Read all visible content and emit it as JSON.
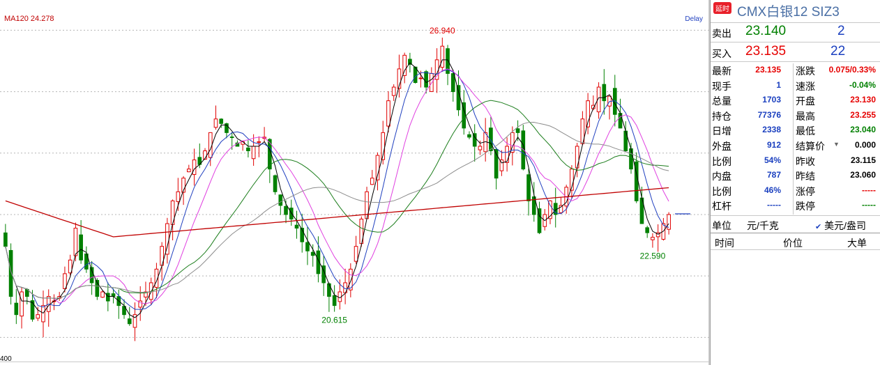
{
  "chart_data": {
    "type": "candlestick",
    "ma_label": "MA120 24.278",
    "delay_label": "Delay",
    "x_axis_label": "400",
    "annotations": [
      {
        "text": "26.940",
        "kind": "high"
      },
      {
        "text": "20.615",
        "kind": "low"
      },
      {
        "text": "22.590",
        "kind": "low"
      }
    ],
    "ylim": [
      19.9,
      27.6
    ],
    "grid_y": [
      27.15,
      25.8,
      24.45,
      23.1,
      21.75,
      20.4
    ],
    "close_series": [
      22.4,
      21.3,
      20.9,
      21.4,
      21.3,
      20.8,
      20.9,
      21.1,
      21.3,
      21.2,
      21.3,
      21.8,
      22.1,
      22.8,
      22.1,
      21.9,
      21.6,
      21.3,
      21.4,
      21.2,
      21.3,
      21.1,
      20.9,
      20.7,
      20.9,
      21.2,
      21.4,
      21.6,
      21.9,
      22.4,
      22.9,
      23.4,
      23.6,
      23.9,
      24.1,
      24.3,
      24.2,
      24.5,
      24.9,
      25.2,
      25.1,
      24.9,
      24.8,
      24.6,
      24.7,
      24.5,
      24.6,
      24.7,
      24.8,
      24.1,
      23.6,
      23.3,
      23.1,
      23.0,
      22.8,
      22.5,
      22.3,
      22.2,
      21.8,
      21.6,
      21.3,
      21.1,
      21.4,
      21.6,
      21.9,
      22.4,
      23.0,
      23.6,
      23.9,
      24.4,
      24.9,
      25.6,
      25.9,
      26.3,
      26.6,
      26.4,
      26.0,
      26.1,
      25.9,
      26.2,
      26.5,
      26.8,
      26.2,
      25.8,
      25.4,
      25.0,
      24.8,
      24.6,
      24.6,
      24.9,
      24.5,
      23.9,
      24.3,
      24.6,
      24.9,
      24.9,
      24.1,
      23.4,
      23.1,
      22.7,
      23.1,
      23.4,
      23.1,
      23.3,
      23.7,
      24.1,
      24.6,
      25.2,
      25.6,
      25.5,
      25.9,
      25.6,
      25.7,
      25.3,
      25.0,
      24.5,
      24.1,
      23.4,
      22.9,
      22.7,
      22.6,
      22.7,
      22.9,
      23.1
    ],
    "y_labels": [],
    "ma_series": [
      {
        "name": "MA5",
        "color": "#000000"
      },
      {
        "name": "MA10",
        "color": "#1f3fbf"
      },
      {
        "name": "MA20",
        "color": "#e040e0"
      },
      {
        "name": "MA60",
        "color": "#1b7d1b"
      },
      {
        "name": "MA90",
        "color": "#8c8c8c"
      },
      {
        "name": "MA120",
        "color": "#c00000"
      }
    ],
    "colors": {
      "up": "#e00000",
      "down": "#008000",
      "grid": "#b4b4b4"
    }
  },
  "quote": {
    "badge": "延时",
    "title": "CMX白银12  SIZ3",
    "sell_label": "卖出",
    "sell_price": "23.140",
    "sell_qty": "2",
    "buy_label": "买入",
    "buy_price": "23.135",
    "buy_qty": "22",
    "left": [
      {
        "label": "最新",
        "value": "23.135",
        "color": "red"
      },
      {
        "label": "现手",
        "value": "1",
        "color": "blue"
      },
      {
        "label": "总量",
        "value": "1703",
        "color": "blue"
      },
      {
        "label": "持仓",
        "value": "77376",
        "color": "blue"
      },
      {
        "label": "日增",
        "value": "2338",
        "color": "blue"
      },
      {
        "label": "外盘",
        "value": "912",
        "color": "blue"
      },
      {
        "label": "比例",
        "value": "54%",
        "color": "blue"
      },
      {
        "label": "内盘",
        "value": "787",
        "color": "blue"
      },
      {
        "label": "比例",
        "value": "46%",
        "color": "blue"
      },
      {
        "label": "杠杆",
        "value": "-----",
        "color": "blue"
      }
    ],
    "right": [
      {
        "label": "涨跌",
        "value": "0.075/0.33%",
        "color": "red"
      },
      {
        "label": "速涨",
        "value": "-0.04%",
        "color": "green"
      },
      {
        "label": "开盘",
        "value": "23.130",
        "color": "red"
      },
      {
        "label": "最高",
        "value": "23.255",
        "color": "red"
      },
      {
        "label": "最低",
        "value": "23.040",
        "color": "green"
      },
      {
        "label": "结算价",
        "value": "0.000",
        "color": "black"
      },
      {
        "label": "昨收",
        "value": "23.115",
        "color": "black"
      },
      {
        "label": "昨结",
        "value": "23.060",
        "color": "black"
      },
      {
        "label": "涨停",
        "value": "-----",
        "color": "red"
      },
      {
        "label": "跌停",
        "value": "-----",
        "color": "green"
      }
    ],
    "unit_label": "单位",
    "unit_value": "元/千克",
    "currency_option": "美元/盎司",
    "trade_headers": [
      "时间",
      "价位",
      "大单"
    ]
  }
}
